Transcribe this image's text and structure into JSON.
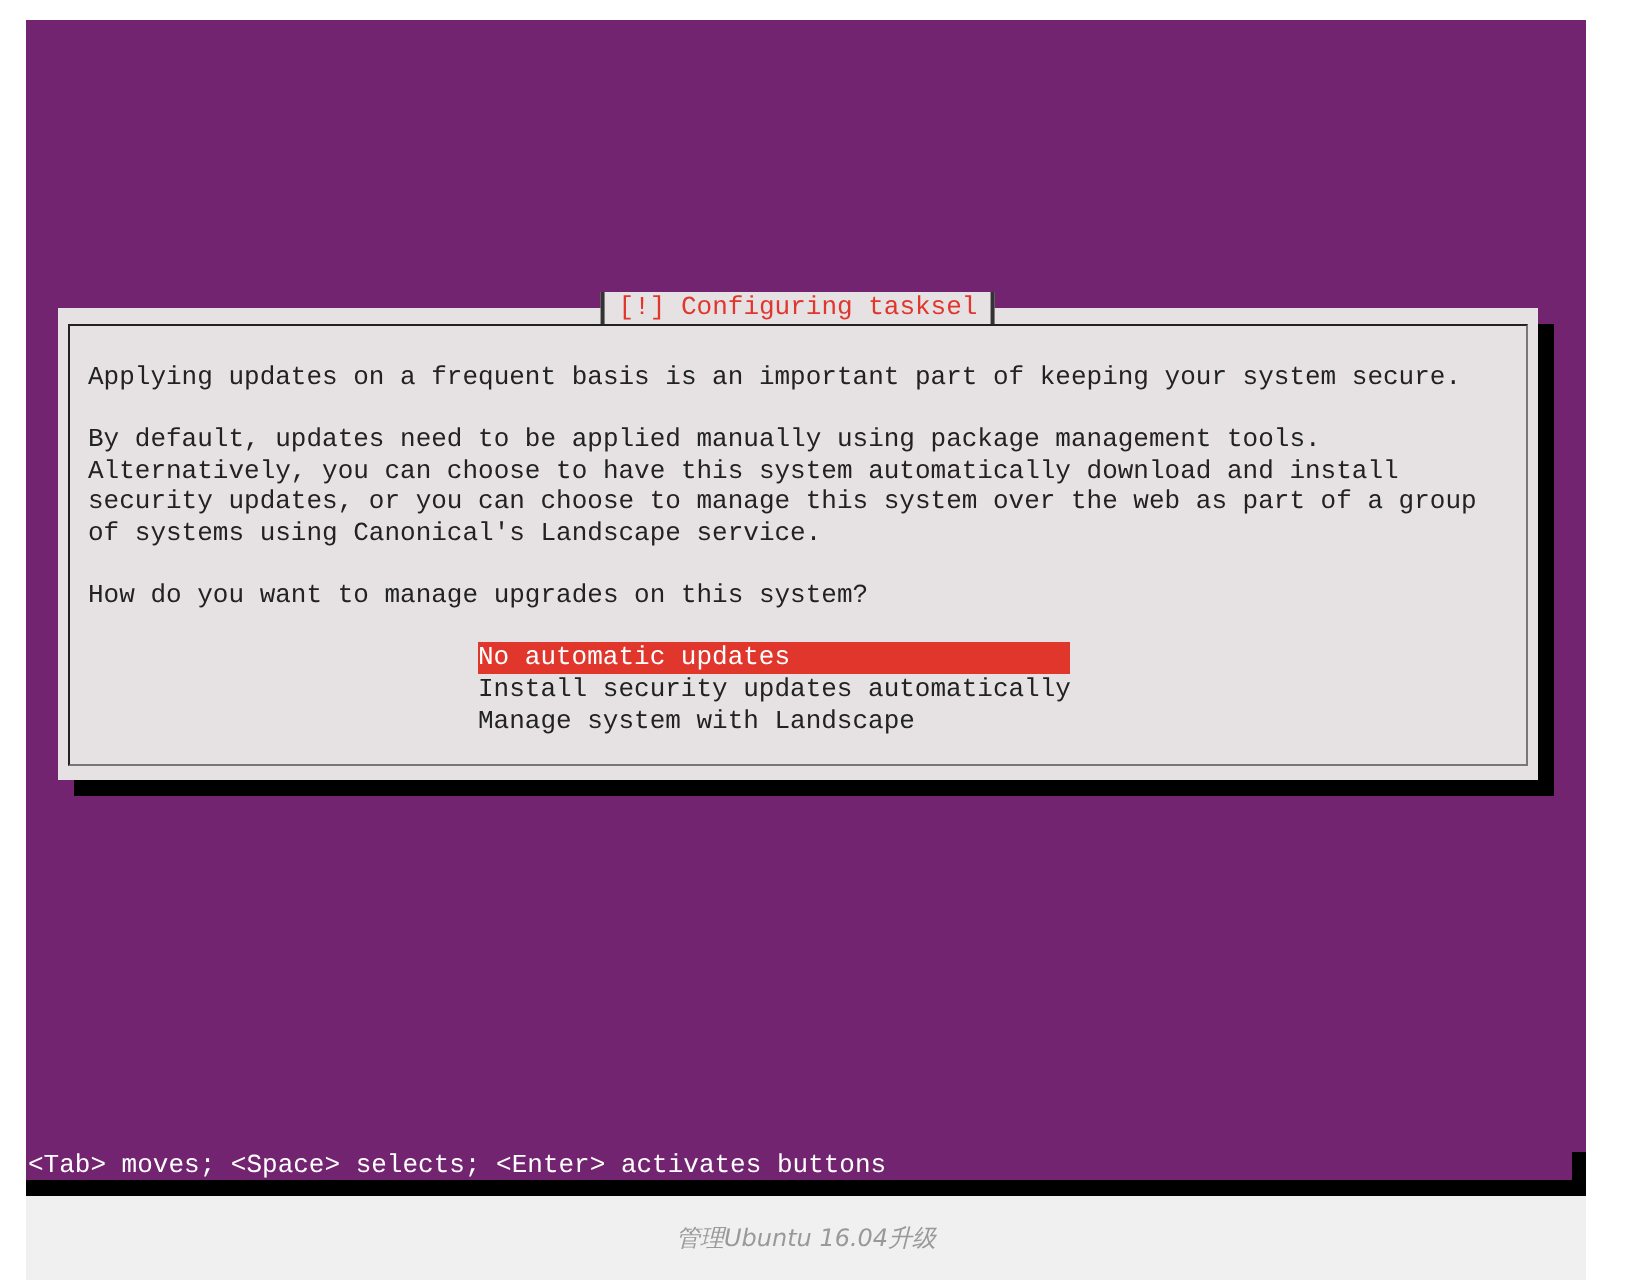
{
  "dialog": {
    "title": "[!] Configuring tasksel",
    "paragraphs": [
      "Applying updates on a frequent basis is an important part of keeping your system secure.",
      "By default, updates need to be applied manually using package management tools.\nAlternatively, you can choose to have this system automatically download and install\nsecurity updates, or you can choose to manage this system over the web as part of a group\nof systems using Canonical's Landscape service.",
      "How do you want to manage upgrades on this system?"
    ],
    "options": [
      {
        "label": "No automatic updates",
        "selected": true
      },
      {
        "label": "Install security updates automatically",
        "selected": false
      },
      {
        "label": "Manage system with Landscape",
        "selected": false
      }
    ]
  },
  "status_bar": "<Tab> moves; <Space> selects; <Enter> activates buttons",
  "caption": "管理Ubuntu 16.04升级"
}
